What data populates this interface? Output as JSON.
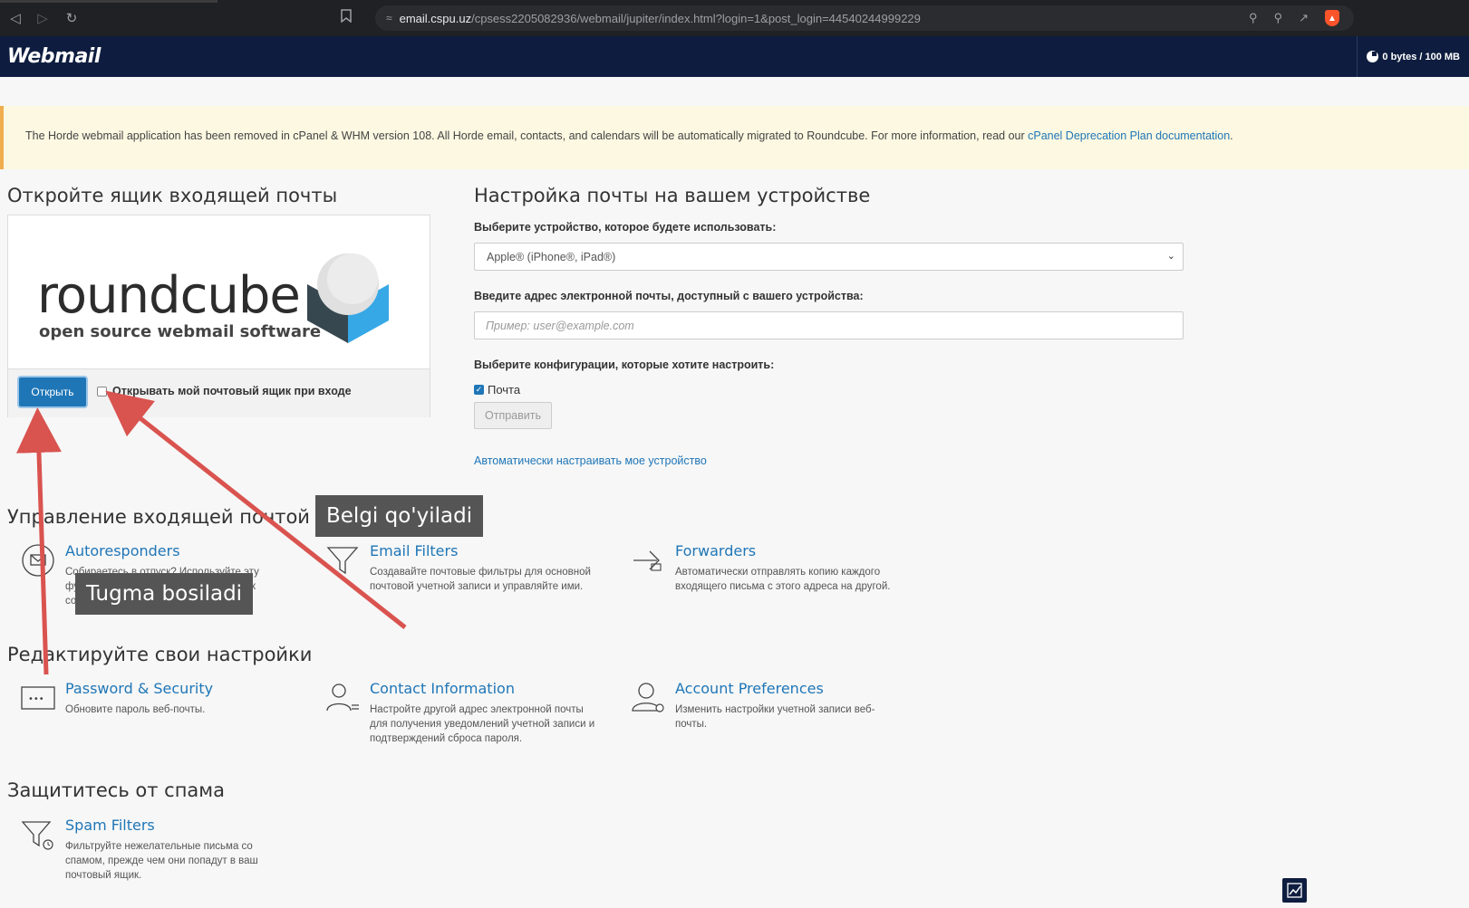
{
  "browser": {
    "url_host": "email.cspu.uz",
    "url_path": "/cpsess2205082936/webmail/jupiter/index.html?login=1&post_login=44540244999229"
  },
  "header": {
    "logo": "Webmail",
    "quota": "0 bytes / 100 MB"
  },
  "notice": {
    "text": "The Horde webmail application has been removed in cPanel & WHM version 108. All Horde email, contacts, and calendars will be automatically migrated to Roundcube. For more information, read our ",
    "link": "cPanel Deprecation Plan documentation",
    "end": "."
  },
  "inbox": {
    "heading": "Откройте ящик входящей почты",
    "logo_word": "roundcube",
    "logo_sub": "open source webmail software",
    "open_button": "Открыть",
    "auto_open_label": "Открывать мой почтовый ящик при входе"
  },
  "device": {
    "heading": "Настройка почты на вашем устройстве",
    "select_label": "Выберите устройство, которое будете использовать:",
    "select_value": "Apple® (iPhone®, iPad®)",
    "email_label": "Введите адрес электронной почты, доступный с вашего устройства:",
    "email_placeholder": "Пример: user@example.com",
    "config_label": "Выберите конфигурации, которые хотите настроить:",
    "mail_option": "Почта",
    "send_button": "Отправить",
    "auto_link": "Автоматически настраивать мое устройство"
  },
  "sections": {
    "manage": "Управление входящей почтой",
    "settings": "Редактируйте свои настройки",
    "spam": "Защититесь от спама"
  },
  "features": {
    "autoresponders": {
      "title": "Autoresponders",
      "desc": "Собираетесь в отпуск? Используйте эту функцию для отправки автоматических сообщений."
    },
    "email_filters": {
      "title": "Email Filters",
      "desc": "Создавайте почтовые фильтры для основной почтовой учетной записи и управляйте ими."
    },
    "forwarders": {
      "title": "Forwarders",
      "desc": "Автоматически отправлять копию каждого входящего письма с этого адреса на другой."
    },
    "password": {
      "title": "Password & Security",
      "desc": "Обновите пароль веб-почты."
    },
    "contact": {
      "title": "Contact Information",
      "desc": "Настройте другой адрес электронной почты для получения уведомлений учетной записи и подтверждений сброса пароля."
    },
    "account": {
      "title": "Account Preferences",
      "desc": "Изменить настройки учетной записи веб-почты."
    },
    "spam_filters": {
      "title": "Spam Filters",
      "desc": "Фильтруйте нежелательные письма со спамом, прежде чем они попадут в ваш почтовый ящик."
    }
  },
  "annotations": {
    "checkbox_tip": "Belgi qo'yiladi",
    "button_tip": "Tugma bosiladi"
  },
  "colors": {
    "header_bg": "#0e1d3f",
    "link": "#1f76b7",
    "arrow": "#d9534f"
  }
}
